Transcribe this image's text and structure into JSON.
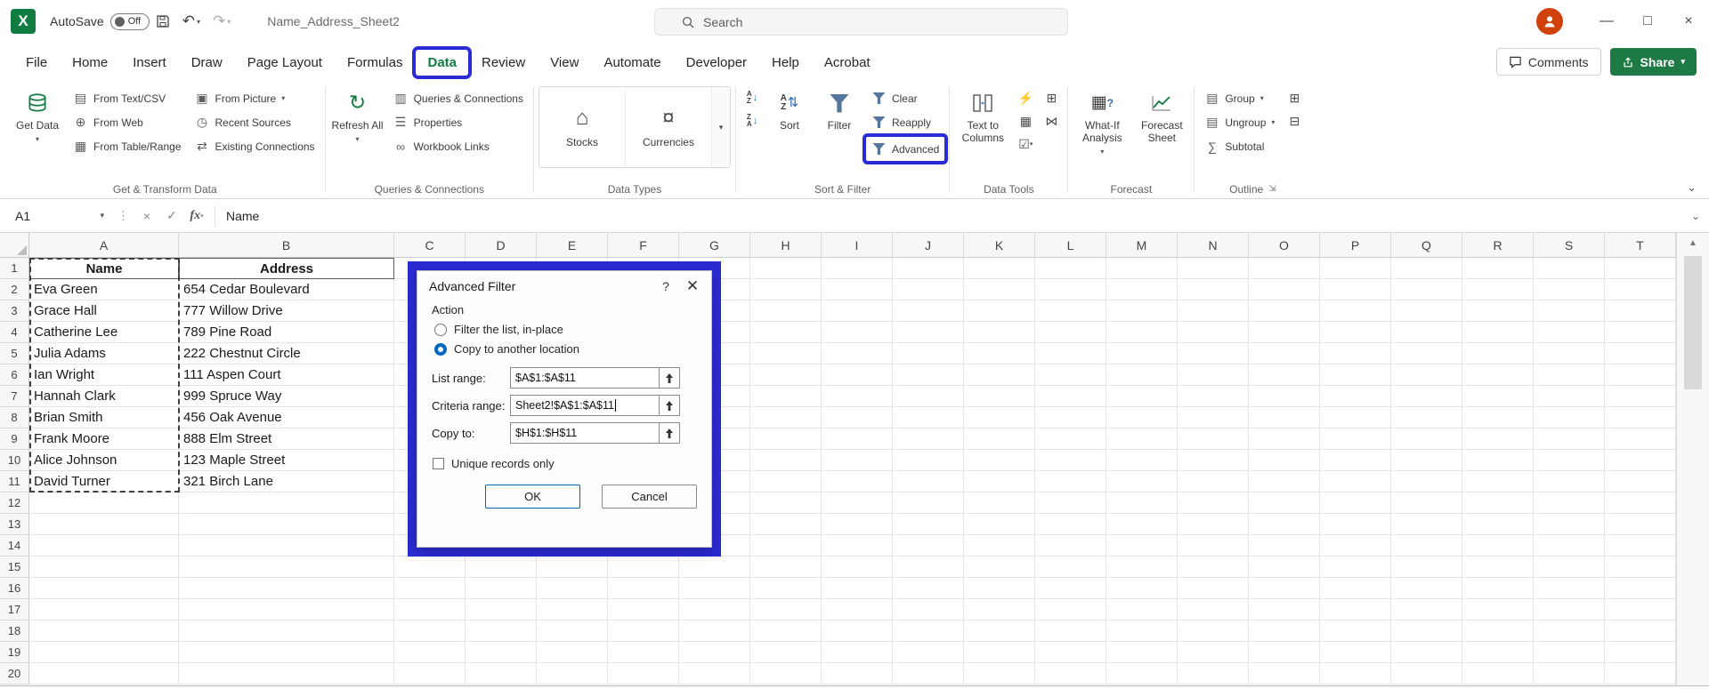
{
  "colors": {
    "excel-green": "#107c41",
    "share-green": "#1e7a45",
    "annotation-blue": "#2b2bd6",
    "accent-blue": "#0067c0",
    "avatar-orange": "#d1410c"
  },
  "titlebar": {
    "autosave_label": "AutoSave",
    "autosave_state": "Off",
    "filename": "Name_Address_Sheet2",
    "search_placeholder": "Search"
  },
  "tabs": [
    "File",
    "Home",
    "Insert",
    "Draw",
    "Page Layout",
    "Formulas",
    "Data",
    "Review",
    "View",
    "Automate",
    "Developer",
    "Help",
    "Acrobat"
  ],
  "active_tab": "Data",
  "actions": {
    "comments": "Comments",
    "share": "Share"
  },
  "ribbon": {
    "groups": {
      "get_transform": {
        "label": "Get & Transform Data",
        "get_data": "Get Data",
        "col1": [
          "From Text/CSV",
          "From Web",
          "From Table/Range"
        ],
        "col2": [
          "From Picture",
          "Recent Sources",
          "Existing Connections"
        ]
      },
      "queries": {
        "label": "Queries & Connections",
        "refresh_all": "Refresh All",
        "col": [
          "Queries & Connections",
          "Properties",
          "Workbook Links"
        ]
      },
      "data_types": {
        "label": "Data Types",
        "gallery": [
          "Stocks",
          "Currencies"
        ]
      },
      "sort_filter": {
        "label": "Sort & Filter",
        "sort": "Sort",
        "filter": "Filter",
        "col": [
          "Clear",
          "Reapply",
          "Advanced"
        ]
      },
      "data_tools": {
        "label": "Data Tools",
        "text_to_columns": "Text to Columns"
      },
      "forecast": {
        "label": "Forecast",
        "what_if": "What-If Analysis",
        "forecast_sheet": "Forecast Sheet"
      },
      "outline": {
        "label": "Outline",
        "col": [
          "Group",
          "Ungroup",
          "Subtotal"
        ]
      }
    }
  },
  "formula_bar": {
    "name_box": "A1",
    "fx": "fx",
    "content": "Name"
  },
  "sheet": {
    "columns": [
      "A",
      "B",
      "C",
      "D",
      "E",
      "F",
      "G",
      "H",
      "I",
      "J",
      "K",
      "L",
      "M",
      "N",
      "O",
      "P",
      "Q",
      "R",
      "S",
      "T"
    ],
    "row_count": 20,
    "selection": "A1:A11",
    "cells": [
      [
        "Name",
        "Address"
      ],
      [
        "Eva Green",
        "654 Cedar Boulevard"
      ],
      [
        "Grace Hall",
        "777 Willow Drive"
      ],
      [
        "Catherine Lee",
        "789 Pine Road"
      ],
      [
        "Julia Adams",
        "222 Chestnut Circle"
      ],
      [
        "Ian Wright",
        "111 Aspen Court"
      ],
      [
        "Hannah Clark",
        "999 Spruce Way"
      ],
      [
        "Brian Smith",
        "456 Oak Avenue"
      ],
      [
        "Frank Moore",
        "888 Elm Street"
      ],
      [
        "Alice Johnson",
        "123 Maple Street"
      ],
      [
        "David Turner",
        "321 Birch Lane"
      ]
    ]
  },
  "dialog": {
    "title": "Advanced Filter",
    "action_label": "Action",
    "radio_filter": "Filter the list, in-place",
    "radio_copy": "Copy to another location",
    "selected_radio": "Copy to another location",
    "fields": [
      {
        "label": "List range:",
        "value": "$A$1:$A$11"
      },
      {
        "label": "Criteria range:",
        "value": "Sheet2!$A$1:$A$11"
      },
      {
        "label": "Copy to:",
        "value": "$H$1:$H$11"
      }
    ],
    "unique_label": "Unique records only",
    "unique_checked": false,
    "ok_label": "OK",
    "cancel_label": "Cancel"
  }
}
